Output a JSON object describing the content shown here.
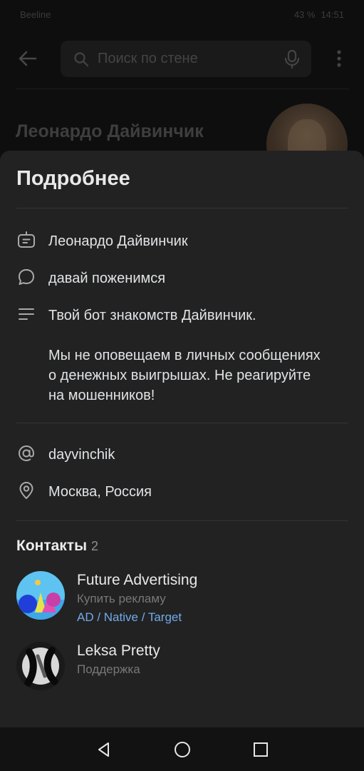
{
  "status_bar": {
    "carrier": "Beeline",
    "battery": "43 %",
    "time": "14:51"
  },
  "topbar": {
    "search_placeholder": "Поиск по стене"
  },
  "background_profile": {
    "name": "Леонардо Дайвинчик"
  },
  "sheet": {
    "title": "Подробнее",
    "info_rows": [
      {
        "icon": "bot-icon",
        "text": "Леонардо Дайвинчик"
      },
      {
        "icon": "chat-bubble-icon",
        "text": "давай поженимся"
      }
    ],
    "about": {
      "icon": "description-lines-icon",
      "line1": "Твой бот знакомств Дайвинчик.",
      "line2": "Мы не оповещаем в личных сообщениях",
      "line3": "о денежных выигрышах. Не реагируйте",
      "line4": "на мошенников!"
    },
    "link_rows": [
      {
        "icon": "at-sign-icon",
        "text": "dayvinchik"
      },
      {
        "icon": "location-pin-icon",
        "text": "Москва, Россия"
      }
    ],
    "contacts": {
      "title": "Контакты",
      "count": "2",
      "items": [
        {
          "name": "Future Advertising",
          "role": "Купить рекламу",
          "extra": "AD / Native / Target"
        },
        {
          "name": "Leksa Pretty",
          "role": "Поддержка"
        }
      ]
    }
  },
  "colors": {
    "sheet_bg": "#222222",
    "accent_link": "#71aaeb",
    "secondary_text": "#76787a"
  }
}
